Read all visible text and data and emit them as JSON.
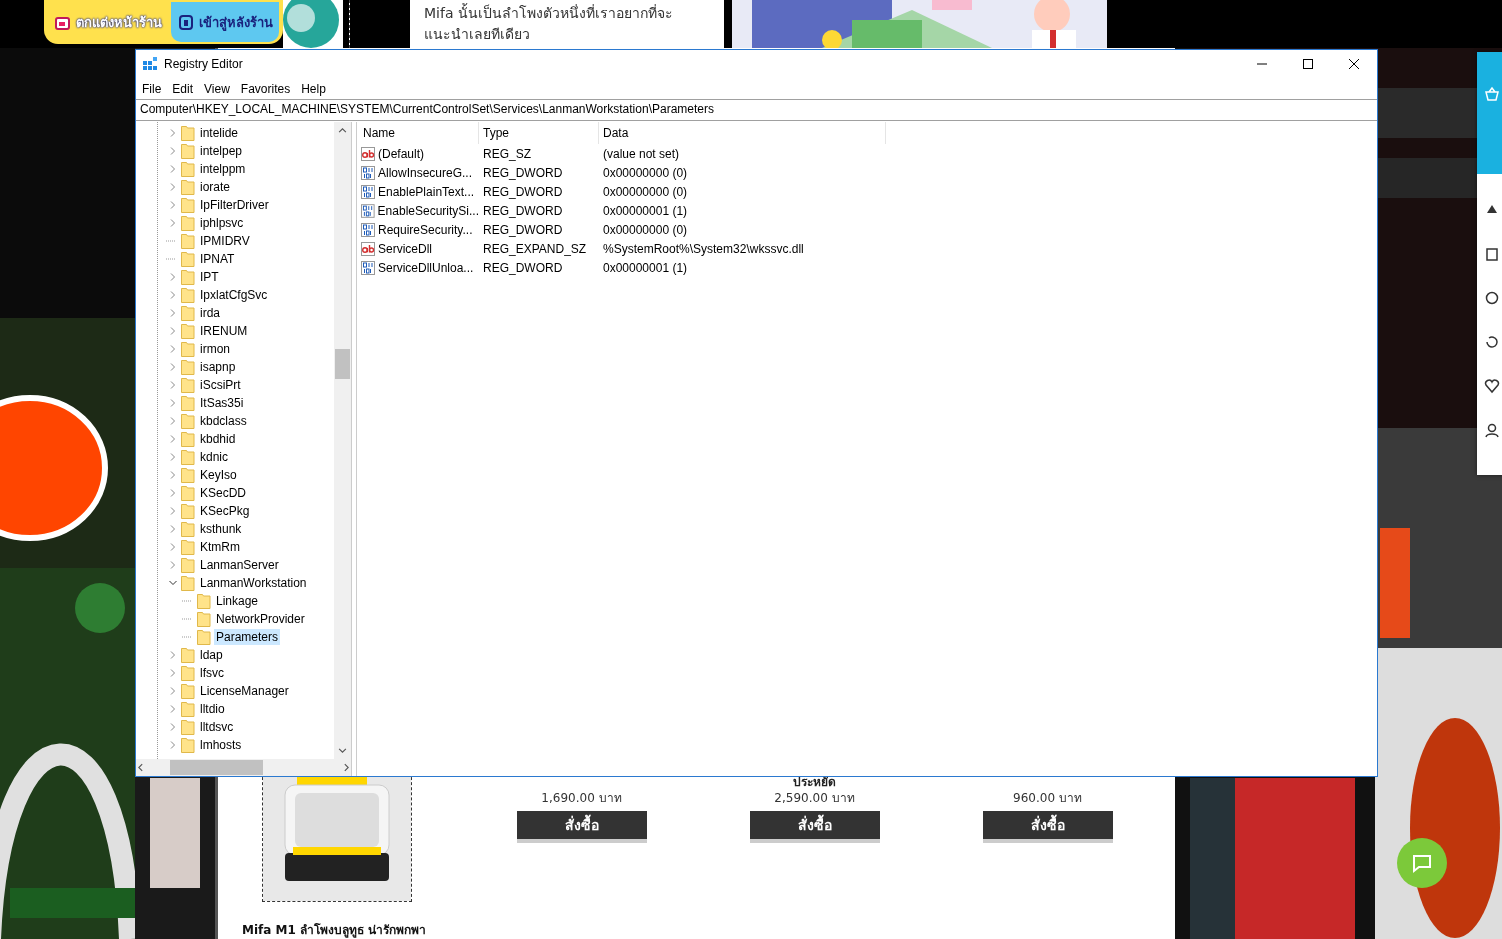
{
  "web_page": {
    "top_buttons": [
      {
        "label": "ตกแต่งหน้าร้าน",
        "kind": "decorate"
      },
      {
        "label": "เข้าสู่หลังร้าน",
        "kind": "backstore"
      }
    ],
    "article_lines": [
      "Mifa นั้นเป็นลำโพงตัวหนึ่งที่เราอยากที่จะ",
      "แนะนำเลยทีเดียว"
    ],
    "products": [
      {
        "price": "1,690.00 บาท",
        "button": "สั่งซื้อ"
      },
      {
        "savings": "ประหยัด",
        "price": "2,590.00 บาท",
        "button": "สั่งซื้อ"
      },
      {
        "price": "960.00 บาท",
        "button": "สั่งซื้อ"
      }
    ],
    "product_title": "Mifa M1 ลำโพงบลูทูธ น่ารักพกพา"
  },
  "registry_editor": {
    "title": "Registry Editor",
    "menu": [
      "File",
      "Edit",
      "View",
      "Favorites",
      "Help"
    ],
    "address": "Computer\\HKEY_LOCAL_MACHINE\\SYSTEM\\CurrentControlSet\\Services\\LanmanWorkstation\\Parameters",
    "tree": [
      {
        "name": "intelide",
        "kind": "collapsed",
        "selected": false
      },
      {
        "name": "intelpep",
        "kind": "collapsed",
        "selected": false
      },
      {
        "name": "intelppm",
        "kind": "collapsed",
        "selected": false
      },
      {
        "name": "iorate",
        "kind": "collapsed",
        "selected": false
      },
      {
        "name": "IpFilterDriver",
        "kind": "collapsed",
        "selected": false
      },
      {
        "name": "iphlpsvc",
        "kind": "collapsed",
        "selected": false
      },
      {
        "name": "IPMIDRV",
        "kind": "leaf",
        "selected": false
      },
      {
        "name": "IPNAT",
        "kind": "leaf",
        "selected": false
      },
      {
        "name": "IPT",
        "kind": "collapsed",
        "selected": false
      },
      {
        "name": "IpxlatCfgSvc",
        "kind": "collapsed",
        "selected": false
      },
      {
        "name": "irda",
        "kind": "collapsed",
        "selected": false
      },
      {
        "name": "IRENUM",
        "kind": "collapsed",
        "selected": false
      },
      {
        "name": "irmon",
        "kind": "collapsed",
        "selected": false
      },
      {
        "name": "isapnp",
        "kind": "collapsed",
        "selected": false
      },
      {
        "name": "iScsiPrt",
        "kind": "collapsed",
        "selected": false
      },
      {
        "name": "ItSas35i",
        "kind": "collapsed",
        "selected": false
      },
      {
        "name": "kbdclass",
        "kind": "collapsed",
        "selected": false
      },
      {
        "name": "kbdhid",
        "kind": "collapsed",
        "selected": false
      },
      {
        "name": "kdnic",
        "kind": "collapsed",
        "selected": false
      },
      {
        "name": "KeyIso",
        "kind": "collapsed",
        "selected": false
      },
      {
        "name": "KSecDD",
        "kind": "collapsed",
        "selected": false
      },
      {
        "name": "KSecPkg",
        "kind": "collapsed",
        "selected": false
      },
      {
        "name": "ksthunk",
        "kind": "collapsed",
        "selected": false
      },
      {
        "name": "KtmRm",
        "kind": "collapsed",
        "selected": false
      },
      {
        "name": "LanmanServer",
        "kind": "collapsed",
        "selected": false
      },
      {
        "name": "LanmanWorkstation",
        "kind": "expanded",
        "selected": false,
        "children": [
          {
            "name": "Linkage",
            "kind": "leaf",
            "selected": false
          },
          {
            "name": "NetworkProvider",
            "kind": "leaf",
            "selected": false
          },
          {
            "name": "Parameters",
            "kind": "leaf",
            "selected": true
          }
        ]
      },
      {
        "name": "ldap",
        "kind": "collapsed",
        "selected": false
      },
      {
        "name": "lfsvc",
        "kind": "collapsed",
        "selected": false
      },
      {
        "name": "LicenseManager",
        "kind": "collapsed",
        "selected": false
      },
      {
        "name": "lltdio",
        "kind": "collapsed",
        "selected": false
      },
      {
        "name": "lltdsvc",
        "kind": "collapsed",
        "selected": false
      },
      {
        "name": "lmhosts",
        "kind": "collapsed",
        "selected": false
      }
    ],
    "columns": [
      "Name",
      "Type",
      "Data"
    ],
    "values": [
      {
        "kind": "string",
        "name": "(Default)",
        "type": "REG_SZ",
        "data": "(value not set)"
      },
      {
        "kind": "binary",
        "name": "AllowInsecureG...",
        "type": "REG_DWORD",
        "data": "0x00000000 (0)"
      },
      {
        "kind": "binary",
        "name": "EnablePlainText...",
        "type": "REG_DWORD",
        "data": "0x00000000 (0)"
      },
      {
        "kind": "binary",
        "name": "EnableSecuritySi...",
        "type": "REG_DWORD",
        "data": "0x00000001 (1)"
      },
      {
        "kind": "binary",
        "name": "RequireSecurity...",
        "type": "REG_DWORD",
        "data": "0x00000000 (0)"
      },
      {
        "kind": "string",
        "name": "ServiceDll",
        "type": "REG_EXPAND_SZ",
        "data": "%SystemRoot%\\System32\\wkssvc.dll"
      },
      {
        "kind": "binary",
        "name": "ServiceDllUnloa...",
        "type": "REG_DWORD",
        "data": "0x00000001 (1)"
      }
    ]
  }
}
